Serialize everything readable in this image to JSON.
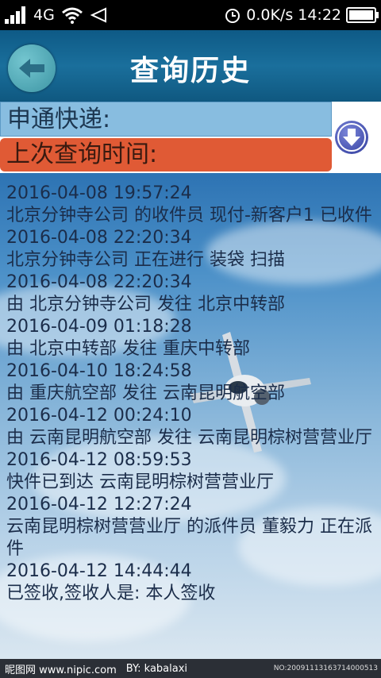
{
  "status_bar": {
    "network": "4G",
    "speed": "0.0K/s",
    "time": "14:22"
  },
  "header": {
    "title": "查询历史"
  },
  "info": {
    "company_label": "申通快递:",
    "last_query_label": "上次查询时间:"
  },
  "logs": [
    {
      "time": "2016-04-08 19:57:24",
      "desc": "北京分钟寺公司 的收件员 现付-新客户1 已收件"
    },
    {
      "time": "2016-04-08 22:20:34",
      "desc": "北京分钟寺公司 正在进行 装袋 扫描"
    },
    {
      "time": "2016-04-08 22:20:34",
      "desc": "由 北京分钟寺公司 发往 北京中转部"
    },
    {
      "time": "2016-04-09 01:18:28",
      "desc": "由 北京中转部 发往 重庆中转部"
    },
    {
      "time": "2016-04-10 18:24:58",
      "desc": "由 重庆航空部 发往 云南昆明航空部"
    },
    {
      "time": "2016-04-12 00:24:10",
      "desc": "由 云南昆明航空部 发往 云南昆明棕树营营业厅"
    },
    {
      "time": "2016-04-12 08:59:53",
      "desc": "快件已到达 云南昆明棕树营营业厅"
    },
    {
      "time": "2016-04-12 12:27:24",
      "desc": "云南昆明棕树营营业厅 的派件员 董毅力 正在派件"
    },
    {
      "time": "2016-04-12 14:44:44",
      "desc": "已签收,签收人是: 本人签收"
    }
  ],
  "footer": {
    "site": "昵图网 www.nipic.com",
    "credit": "BY: kabalaxi",
    "id": "NO:20091113163714000513"
  }
}
